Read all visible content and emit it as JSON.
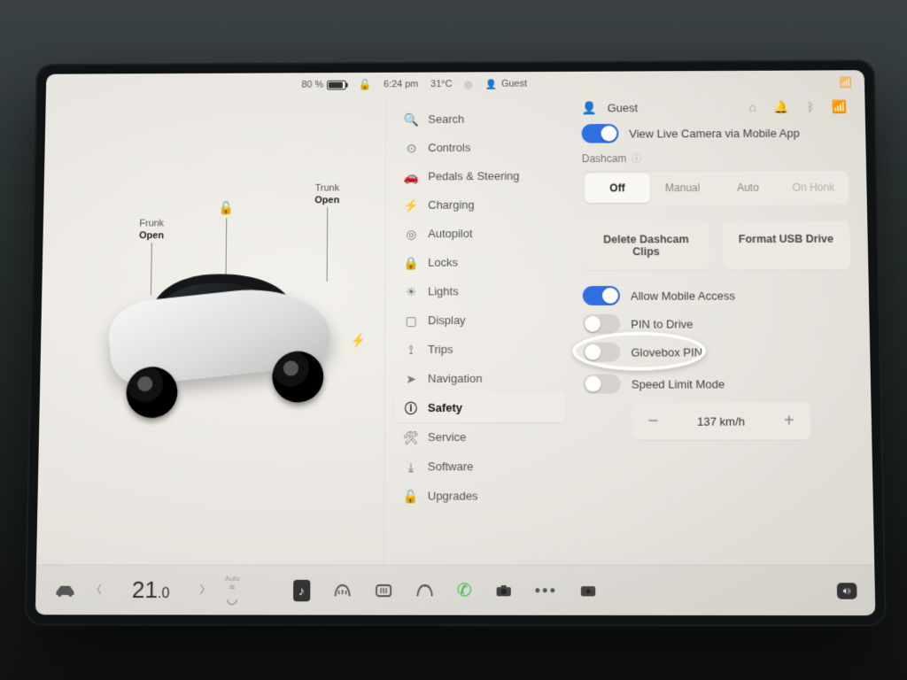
{
  "statusbar": {
    "battery_pct": "80 %",
    "time": "6:24 pm",
    "temp": "31°C",
    "user": "Guest"
  },
  "car": {
    "frunk_label": "Frunk",
    "frunk_state": "Open",
    "trunk_label": "Trunk",
    "trunk_state": "Open"
  },
  "menu": {
    "items": [
      {
        "icon": "🔍",
        "label": "Search"
      },
      {
        "icon": "⊙",
        "label": "Controls"
      },
      {
        "icon": "🚗",
        "label": "Pedals & Steering"
      },
      {
        "icon": "⚡",
        "label": "Charging"
      },
      {
        "icon": "◎",
        "label": "Autopilot"
      },
      {
        "icon": "🔒",
        "label": "Locks"
      },
      {
        "icon": "☀",
        "label": "Lights"
      },
      {
        "icon": "▢",
        "label": "Display"
      },
      {
        "icon": "⟟",
        "label": "Trips"
      },
      {
        "icon": "➤",
        "label": "Navigation"
      },
      {
        "icon": "ⓘ",
        "label": "Safety"
      },
      {
        "icon": "🛠",
        "label": "Service"
      },
      {
        "icon": "⤓",
        "label": "Software"
      },
      {
        "icon": "🔓",
        "label": "Upgrades"
      }
    ],
    "selected_index": 10
  },
  "content": {
    "user": "Guest",
    "live_camera": {
      "label": "View Live Camera via Mobile App",
      "on": true
    },
    "dashcam": {
      "label": "Dashcam",
      "options": [
        "Off",
        "Manual",
        "Auto",
        "On Honk"
      ],
      "selected": 0
    },
    "buttons": {
      "delete": "Delete Dashcam Clips",
      "format": "Format USB Drive"
    },
    "mobile_access": {
      "label": "Allow Mobile Access",
      "on": true
    },
    "pin_drive": {
      "label": "PIN to Drive",
      "on": false
    },
    "glovebox": {
      "label": "Glovebox PIN",
      "on": false
    },
    "speed_limit": {
      "label": "Speed Limit Mode",
      "on": false,
      "value": "137 km/h"
    }
  },
  "dock": {
    "temp_int": "21",
    "temp_dec": ".0",
    "seat_auto": "Auto"
  }
}
